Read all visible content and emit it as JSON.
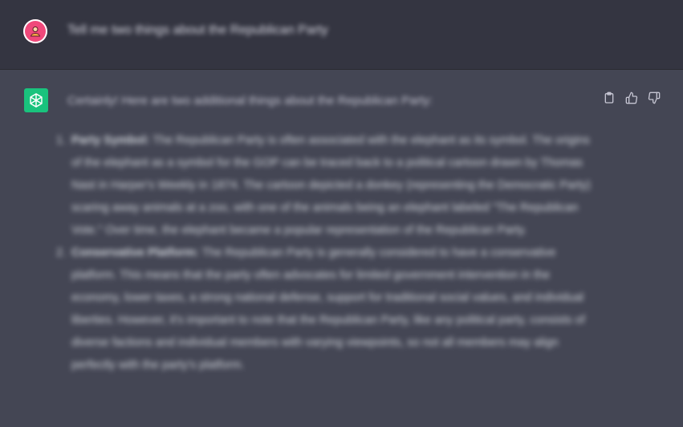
{
  "conversation": {
    "user_message": "Tell me two things about the Republican Party",
    "assistant": {
      "intro": "Certainly! Here are two additional things about the Republican Party:",
      "items": [
        {
          "number": "1.",
          "title": "Party Symbol:",
          "text": "The Republican Party is often associated with the elephant as its symbol. The origins of the elephant as a symbol for the GOP can be traced back to a political cartoon drawn by Thomas Nast in Harper's Weekly in 1874. The cartoon depicted a donkey (representing the Democratic Party) scaring away animals at a zoo, with one of the animals being an elephant labeled \"The Republican Vote.\" Over time, the elephant became a popular representation of the Republican Party."
        },
        {
          "number": "2.",
          "title": "Conservative Platform:",
          "text": "The Republican Party is generally considered to have a conservative platform. This means that the party often advocates for limited government intervention in the economy, lower taxes, a strong national defense, support for traditional social values, and individual liberties. However, it's important to note that the Republican Party, like any political party, consists of diverse factions and individual members with varying viewpoints, so not all members may align perfectly with the party's platform."
        }
      ]
    }
  },
  "icons": {
    "user_avatar": "user-avatar-icon",
    "assistant_avatar": "openai-logo-icon",
    "copy": "clipboard-icon",
    "like": "thumbs-up-icon",
    "dislike": "thumbs-down-icon"
  },
  "colors": {
    "user_row_bg": "#343541",
    "assistant_row_bg": "#444654",
    "assistant_avatar_bg": "#19c37d",
    "user_avatar_bg": "#f0487a"
  }
}
